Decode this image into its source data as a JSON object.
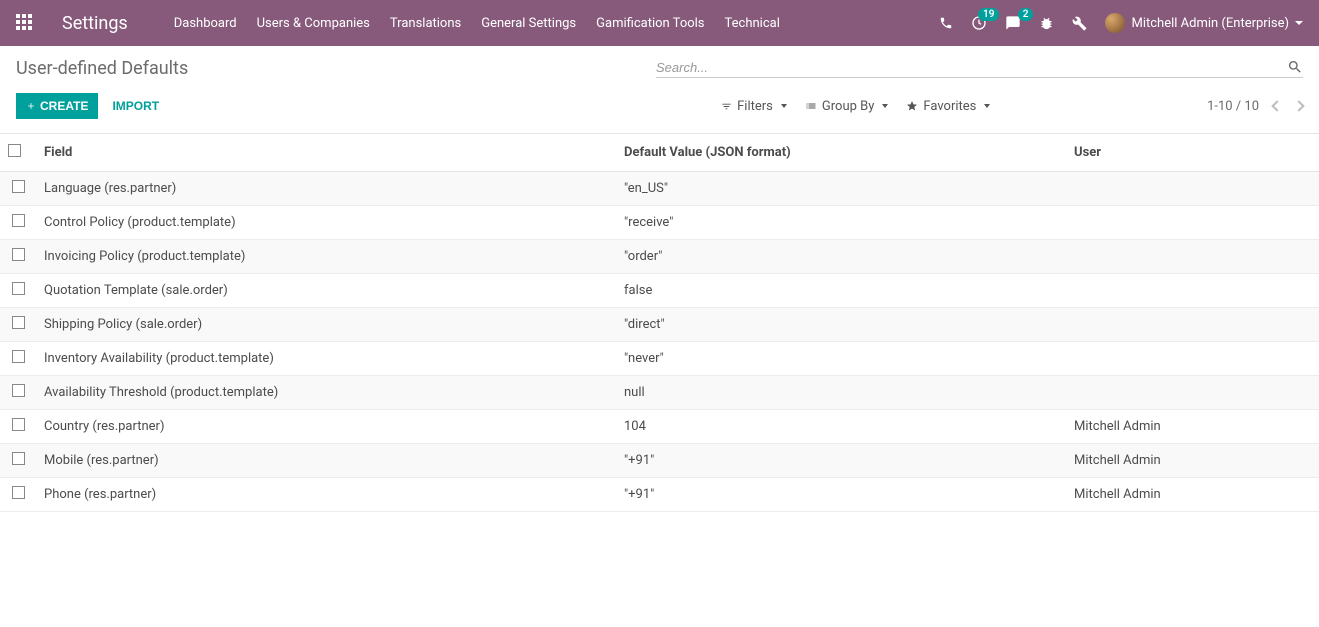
{
  "nav": {
    "brand": "Settings",
    "menus": [
      "Dashboard",
      "Users & Companies",
      "Translations",
      "General Settings",
      "Gamification Tools",
      "Technical"
    ],
    "activities_badge": "19",
    "messages_badge": "2",
    "user_label": "Mitchell Admin (Enterprise)"
  },
  "breadcrumb": "User-defined Defaults",
  "search": {
    "placeholder": "Search..."
  },
  "buttons": {
    "create": "CREATE",
    "import": "IMPORT"
  },
  "tools": {
    "filters": "Filters",
    "group_by": "Group By",
    "favorites": "Favorites"
  },
  "pager": "1-10 / 10",
  "columns": {
    "field": "Field",
    "value": "Default Value (JSON format)",
    "user": "User"
  },
  "rows": [
    {
      "field": "Language (res.partner)",
      "value": "\"en_US\"",
      "user": ""
    },
    {
      "field": "Control Policy (product.template)",
      "value": "\"receive\"",
      "user": ""
    },
    {
      "field": "Invoicing Policy (product.template)",
      "value": "\"order\"",
      "user": ""
    },
    {
      "field": "Quotation Template (sale.order)",
      "value": "false",
      "user": ""
    },
    {
      "field": "Shipping Policy (sale.order)",
      "value": "\"direct\"",
      "user": ""
    },
    {
      "field": "Inventory Availability (product.template)",
      "value": "\"never\"",
      "user": ""
    },
    {
      "field": "Availability Threshold (product.template)",
      "value": "null",
      "user": ""
    },
    {
      "field": "Country (res.partner)",
      "value": "104",
      "user": "Mitchell Admin"
    },
    {
      "field": "Mobile (res.partner)",
      "value": "\"+91\"",
      "user": "Mitchell Admin"
    },
    {
      "field": "Phone (res.partner)",
      "value": "\"+91\"",
      "user": "Mitchell Admin"
    }
  ]
}
